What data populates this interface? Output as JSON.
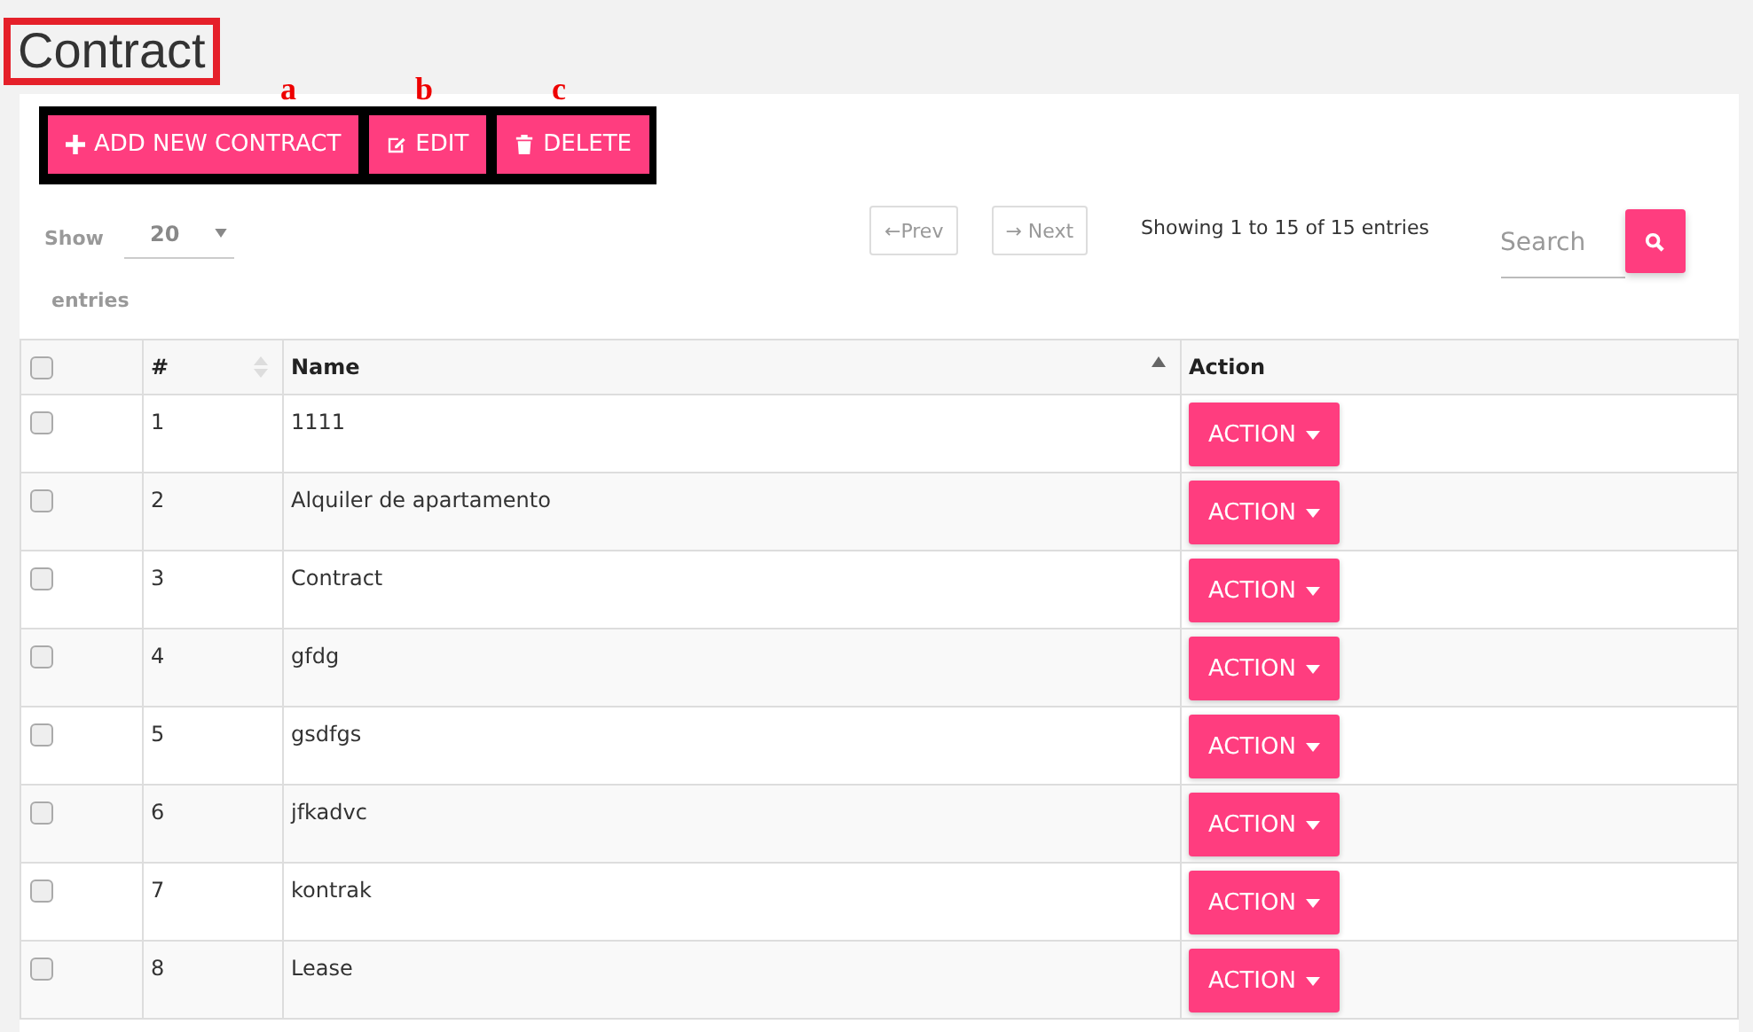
{
  "page_title": "Contract",
  "annotations": [
    "a",
    "b",
    "c"
  ],
  "toolbar": [
    {
      "kind": "add",
      "label": "ADD NEW CONTRACT"
    },
    {
      "kind": "edit",
      "label": "EDIT"
    },
    {
      "kind": "delete",
      "label": "DELETE"
    }
  ],
  "length_menu": {
    "show_label": "Show",
    "value": "20",
    "entries_label": "entries"
  },
  "pagination": {
    "prev": "←Prev",
    "next": "→ Next"
  },
  "info": "Showing 1 to 15 of 15 entries",
  "search": {
    "placeholder": "Search"
  },
  "table": {
    "select_all_checked": false,
    "columns": [
      "#",
      "Name",
      "Action"
    ],
    "rows": [
      {
        "checked": false,
        "number": "1",
        "name": "1111",
        "action": "ACTION"
      },
      {
        "checked": false,
        "number": "2",
        "name": "Alquiler de apartamento",
        "action": "ACTION"
      },
      {
        "checked": false,
        "number": "3",
        "name": "Contract",
        "action": "ACTION"
      },
      {
        "checked": false,
        "number": "4",
        "name": "gfdg",
        "action": "ACTION"
      },
      {
        "checked": false,
        "number": "5",
        "name": "gsdfgs",
        "action": "ACTION"
      },
      {
        "checked": false,
        "number": "6",
        "name": "jfkadvc",
        "action": "ACTION"
      },
      {
        "checked": false,
        "number": "7",
        "name": "kontrak",
        "action": "ACTION"
      },
      {
        "checked": false,
        "number": "8",
        "name": "Lease",
        "action": "ACTION"
      }
    ]
  }
}
